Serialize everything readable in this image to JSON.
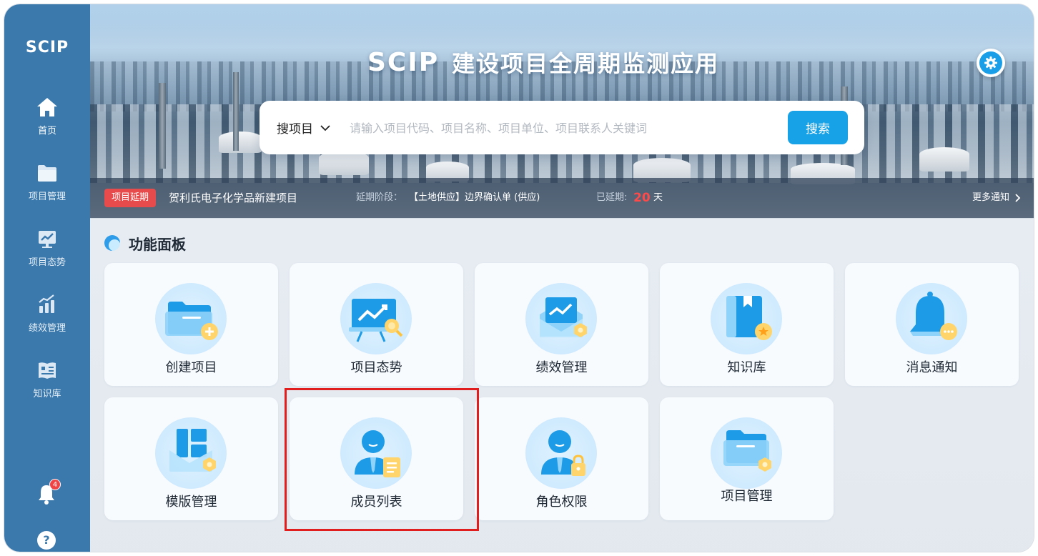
{
  "sidebar": {
    "logo": "SCIP",
    "items": [
      {
        "label": "首页",
        "icon": "home-icon",
        "active": true
      },
      {
        "label": "项目管理",
        "icon": "folder-icon"
      },
      {
        "label": "项目态势",
        "icon": "trend-chart-icon"
      },
      {
        "label": "绩效管理",
        "icon": "bar-chart-icon"
      },
      {
        "label": "知识库",
        "icon": "book-icon"
      }
    ],
    "notification_count": "4",
    "help_label": "?"
  },
  "header": {
    "logo": "SCIP",
    "title": "建设项目全周期监测应用"
  },
  "search": {
    "scope": "搜项目",
    "placeholder": "请输入项目代码、项目名称、项目单位、项目联系人关键词",
    "button": "搜索"
  },
  "notice": {
    "tag": "项目延期",
    "project": "贺利氏电子化学品新建项目",
    "stage_label": "延期阶段：",
    "stage_value": "【土地供应】边界确认单 (供应)",
    "delay_label": "已延期:",
    "delay_days": "20",
    "delay_unit": "天",
    "more": "更多通知"
  },
  "panel": {
    "title": "功能面板",
    "cards": [
      {
        "label": "创建项目",
        "icon": "create-project-icon"
      },
      {
        "label": "项目态势",
        "icon": "project-trend-icon"
      },
      {
        "label": "绩效管理",
        "icon": "performance-icon"
      },
      {
        "label": "知识库",
        "icon": "knowledge-book-icon"
      },
      {
        "label": "消息通知",
        "icon": "bell-icon"
      },
      {
        "label": "模版管理",
        "icon": "template-icon"
      },
      {
        "label": "成员列表",
        "icon": "member-list-icon"
      },
      {
        "label": "角色权限",
        "icon": "role-permission-icon"
      },
      {
        "label": "项目管理",
        "icon": "project-folder-icon"
      }
    ]
  },
  "colors": {
    "sidebar": "#3b79ad",
    "accent": "#17a1e6",
    "alert": "#e84b4b",
    "highlight": "#e01e1e"
  }
}
